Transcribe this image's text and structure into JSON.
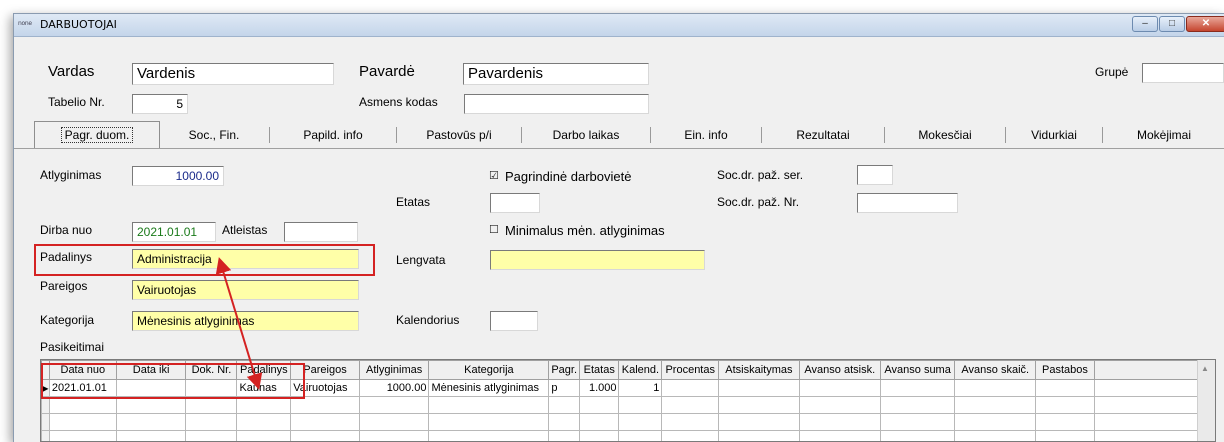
{
  "window": {
    "app_icon": "none",
    "title": "DARBUOTOJAI",
    "minimize_glyph": "–",
    "maximize_glyph": "□",
    "close_glyph": "✕"
  },
  "header": {
    "vardas_label": "Vardas",
    "vardas_value": "Vardenis",
    "pavarde_label": "Pavardė",
    "pavarde_value": "Pavardenis",
    "grupe_label": "Grupė",
    "grupe_value": "",
    "tabelio_label": "Tabelio Nr.",
    "tabelio_value": "5",
    "asmens_label": "Asmens kodas",
    "asmens_value": ""
  },
  "tabs": [
    {
      "label": "Pagr. duom."
    },
    {
      "label": "Soc., Fin."
    },
    {
      "label": "Papild. info"
    },
    {
      "label": "Pastovūs p/i"
    },
    {
      "label": "Darbo laikas"
    },
    {
      "label": "Ein. info"
    },
    {
      "label": "Rezultatai"
    },
    {
      "label": "Mokesčiai"
    },
    {
      "label": "Vidurkiai"
    },
    {
      "label": "Mokėjimai"
    }
  ],
  "form": {
    "atlyginimas_label": "Atlyginimas",
    "atlyginimas_value": "1000.00",
    "pagrindine_label": "Pagrindinė darbovietė",
    "pagrindine_checked": true,
    "check_glyph": "☑",
    "uncheck_glyph": "☐",
    "socdr_ser_label": "Soc.dr. paž. ser.",
    "socdr_ser_value": "",
    "etatas_label": "Etatas",
    "etatas_value": "",
    "socdr_nr_label": "Soc.dr. paž. Nr.",
    "socdr_nr_value": "",
    "dirba_label": "Dirba nuo",
    "dirba_value": "2021.01.01",
    "atleistas_label": "Atleistas",
    "atleistas_value": "",
    "minimalus_label": "Minimalus mėn. atlyginimas",
    "minimalus_checked": false,
    "padalinys_label": "Padalinys",
    "padalinys_value": "Administracija",
    "lengvata_label": "Lengvata",
    "lengvata_value": "",
    "pareigos_label": "Pareigos",
    "pareigos_value": "Vairuotojas",
    "kategorija_label": "Kategorija",
    "kategorija_value": "Mėnesinis atlyginimas",
    "kalendorius_label": "Kalendorius",
    "kalendorius_value": "",
    "pasikeitimai_label": "Pasikeitimai"
  },
  "grid": {
    "columns": [
      "",
      "Data nuo",
      "Data iki",
      "Dok. Nr.",
      "Padalinys",
      "Pareigos",
      "Atlyginimas",
      "Kategorija",
      "Pagr.",
      "Etatas",
      "Kalend.",
      "Procentas",
      "Atsiskaitymas",
      "Avanso atsisk.",
      "Avanso suma",
      "Avanso skaič.",
      "Pastabos",
      ""
    ],
    "rows": [
      [
        "▶",
        "2021.01.01",
        "",
        "",
        "Kaunas",
        "Vairuotojas",
        "1000.00",
        "Mėnesinis atlyginimas",
        "p",
        "1.000",
        "1",
        "",
        "",
        "",
        "",
        "",
        "",
        ""
      ],
      [
        "",
        "",
        "",
        "",
        "",
        "",
        "",
        "",
        "",
        "",
        "",
        "",
        "",
        "",
        "",
        "",
        "",
        ""
      ],
      [
        "",
        "",
        "",
        "",
        "",
        "",
        "",
        "",
        "",
        "",
        "",
        "",
        "",
        "",
        "",
        "",
        "",
        ""
      ],
      [
        "",
        "",
        "",
        "",
        "",
        "",
        "",
        "",
        "",
        "",
        "",
        "",
        "",
        "",
        "",
        "",
        "",
        ""
      ]
    ]
  },
  "colors": {
    "highlight_red": "#d42222",
    "field_yellow": "#ffffa8",
    "date_green": "#1a7a1a",
    "salary_blue": "#1a2a8a"
  }
}
